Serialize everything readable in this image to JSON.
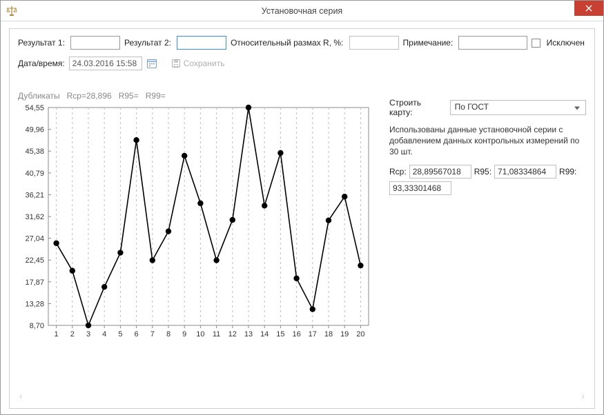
{
  "window": {
    "title": "Установочная серия"
  },
  "form": {
    "result1_label": "Результат 1:",
    "result1_value": "",
    "result2_label": "Результат 2:",
    "result2_value": "",
    "rel_range_label": "Относительный размах R, %:",
    "rel_range_value": "",
    "note_label": "Примечание:",
    "note_value": "",
    "excluded_label": "Исключен",
    "datetime_label": "Дата/время:",
    "datetime_value": "24.03.2016 15:58",
    "save_label": "Сохранить"
  },
  "chart_meta": {
    "title_prefix": "Дубликаты",
    "rcp_label": "Rcp=28,896",
    "r95_label": "R95=",
    "r99_label": "R99="
  },
  "right": {
    "build_label": "Строить карту:",
    "build_option": "По ГОСТ",
    "description": "Использованы данные установочной серии с добавлением данных контрольных измерений по 30 шт.",
    "rcp_label": "Rcp:",
    "rcp_value": "28,89567018",
    "r95_label": "R95:",
    "r95_value": "71,08334864",
    "r99_label": "R99:",
    "r99_value": "93,33301468"
  },
  "chart_data": {
    "type": "line",
    "categories": [
      1,
      2,
      3,
      4,
      5,
      6,
      7,
      8,
      9,
      10,
      11,
      12,
      13,
      14,
      15,
      16,
      17,
      18,
      19,
      20
    ],
    "values": [
      26.0,
      20.2,
      8.7,
      16.8,
      24.0,
      47.7,
      22.4,
      28.5,
      44.4,
      34.4,
      22.4,
      30.9,
      54.55,
      33.9,
      45.0,
      18.6,
      12.1,
      30.8,
      35.8,
      21.3
    ],
    "ylim": [
      8.7,
      54.55
    ],
    "yticks": [
      8.7,
      13.28,
      17.87,
      22.45,
      27.04,
      31.62,
      36.21,
      40.79,
      45.38,
      49.96,
      54.55
    ],
    "xlabel": "",
    "ylabel": "",
    "title": ""
  }
}
